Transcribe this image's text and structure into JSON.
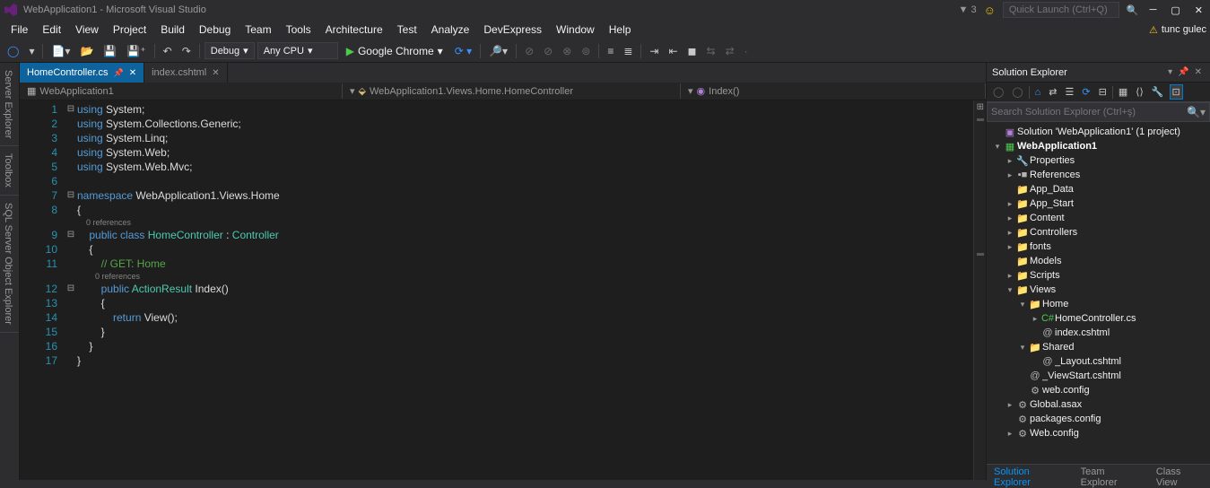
{
  "title": "WebApplication1 - Microsoft Visual Studio",
  "notification_count": "3",
  "quick_launch_placeholder": "Quick Launch (Ctrl+Q)",
  "user_name": "tunc gulec",
  "menu": [
    "File",
    "Edit",
    "View",
    "Project",
    "Build",
    "Debug",
    "Team",
    "Tools",
    "Architecture",
    "Test",
    "Analyze",
    "DevExpress",
    "Window",
    "Help"
  ],
  "toolbar": {
    "debug_config": "Debug",
    "platform": "Any CPU",
    "browser": "Google Chrome"
  },
  "editor_tabs": [
    {
      "label": "HomeController.cs",
      "active": true,
      "pinned": true
    },
    {
      "label": "index.cshtml",
      "active": false,
      "pinned": false
    }
  ],
  "nav": {
    "project": "WebApplication1",
    "type": "WebApplication1.Views.Home.HomeController",
    "member": "Index()"
  },
  "codelens": "0 references",
  "code_lines": [
    {
      "n": 1,
      "fold": "⊟",
      "tokens": [
        [
          "kw",
          "using"
        ],
        [
          "plain",
          " System;"
        ]
      ]
    },
    {
      "n": 2,
      "fold": "",
      "tokens": [
        [
          "kw",
          "using"
        ],
        [
          "plain",
          " System.Collections.Generic;"
        ]
      ]
    },
    {
      "n": 3,
      "fold": "",
      "tokens": [
        [
          "kw",
          "using"
        ],
        [
          "plain",
          " System.Linq;"
        ]
      ]
    },
    {
      "n": 4,
      "fold": "",
      "tokens": [
        [
          "kw",
          "using"
        ],
        [
          "plain",
          " System.Web;"
        ]
      ]
    },
    {
      "n": 5,
      "fold": "",
      "tokens": [
        [
          "kw",
          "using"
        ],
        [
          "plain",
          " System.Web.Mvc;"
        ]
      ]
    },
    {
      "n": 6,
      "fold": "",
      "tokens": [
        [
          "plain",
          ""
        ]
      ]
    },
    {
      "n": 7,
      "fold": "⊟",
      "tokens": [
        [
          "kw",
          "namespace"
        ],
        [
          "plain",
          " WebApplication1.Views.Home"
        ]
      ]
    },
    {
      "n": 8,
      "fold": "",
      "tokens": [
        [
          "plain",
          "{"
        ]
      ]
    },
    {
      "n": 9,
      "fold": "⊟",
      "codelens_before": true,
      "indent": "    ",
      "tokens": [
        [
          "plain",
          "    "
        ],
        [
          "kw",
          "public"
        ],
        [
          "plain",
          " "
        ],
        [
          "kw",
          "class"
        ],
        [
          "plain",
          " "
        ],
        [
          "type",
          "HomeController"
        ],
        [
          "plain",
          " : "
        ],
        [
          "type",
          "Controller"
        ]
      ]
    },
    {
      "n": 10,
      "fold": "",
      "tokens": [
        [
          "plain",
          "    {"
        ]
      ]
    },
    {
      "n": 11,
      "fold": "",
      "tokens": [
        [
          "plain",
          "        "
        ],
        [
          "comment",
          "// GET: Home"
        ]
      ]
    },
    {
      "n": 12,
      "fold": "⊟",
      "codelens_before": true,
      "indent": "        ",
      "tokens": [
        [
          "plain",
          "        "
        ],
        [
          "kw",
          "public"
        ],
        [
          "plain",
          " "
        ],
        [
          "type",
          "ActionResult"
        ],
        [
          "plain",
          " Index()"
        ]
      ]
    },
    {
      "n": 13,
      "fold": "",
      "tokens": [
        [
          "plain",
          "        {"
        ]
      ]
    },
    {
      "n": 14,
      "fold": "",
      "tokens": [
        [
          "plain",
          "            "
        ],
        [
          "kw",
          "return"
        ],
        [
          "plain",
          " View();"
        ]
      ]
    },
    {
      "n": 15,
      "fold": "",
      "tokens": [
        [
          "plain",
          "        }"
        ]
      ]
    },
    {
      "n": 16,
      "fold": "",
      "tokens": [
        [
          "plain",
          "    }"
        ]
      ]
    },
    {
      "n": 17,
      "fold": "",
      "tokens": [
        [
          "plain",
          "}"
        ]
      ]
    }
  ],
  "solution_explorer": {
    "title": "Solution Explorer",
    "search_placeholder": "Search Solution Explorer (Ctrl+ş)",
    "bottom_tabs": [
      "Solution Explorer",
      "Team Explorer",
      "Class View"
    ],
    "tree": [
      {
        "depth": 0,
        "exp": "",
        "icon": "sln",
        "label": "Solution 'WebApplication1' (1 project)"
      },
      {
        "depth": 0,
        "exp": "▾",
        "icon": "proj",
        "label": "WebApplication1",
        "bold": true
      },
      {
        "depth": 1,
        "exp": "▸",
        "icon": "wrench",
        "label": "Properties"
      },
      {
        "depth": 1,
        "exp": "▸",
        "icon": "ref",
        "label": "References"
      },
      {
        "depth": 1,
        "exp": "",
        "icon": "folder",
        "label": "App_Data"
      },
      {
        "depth": 1,
        "exp": "▸",
        "icon": "folder",
        "label": "App_Start"
      },
      {
        "depth": 1,
        "exp": "▸",
        "icon": "folder",
        "label": "Content"
      },
      {
        "depth": 1,
        "exp": "▸",
        "icon": "folder",
        "label": "Controllers"
      },
      {
        "depth": 1,
        "exp": "▸",
        "icon": "folder",
        "label": "fonts"
      },
      {
        "depth": 1,
        "exp": "",
        "icon": "folder",
        "label": "Models"
      },
      {
        "depth": 1,
        "exp": "▸",
        "icon": "folder",
        "label": "Scripts"
      },
      {
        "depth": 1,
        "exp": "▾",
        "icon": "folder",
        "label": "Views"
      },
      {
        "depth": 2,
        "exp": "▾",
        "icon": "folder",
        "label": "Home"
      },
      {
        "depth": 3,
        "exp": "▸",
        "icon": "cs",
        "label": "HomeController.cs"
      },
      {
        "depth": 3,
        "exp": "",
        "icon": "cshtml",
        "label": "index.cshtml"
      },
      {
        "depth": 2,
        "exp": "▾",
        "icon": "folder",
        "label": "Shared"
      },
      {
        "depth": 3,
        "exp": "",
        "icon": "cshtml",
        "label": "_Layout.cshtml"
      },
      {
        "depth": 2,
        "exp": "",
        "icon": "cshtml",
        "label": "_ViewStart.cshtml"
      },
      {
        "depth": 2,
        "exp": "",
        "icon": "config",
        "label": "web.config"
      },
      {
        "depth": 1,
        "exp": "▸",
        "icon": "asax",
        "label": "Global.asax"
      },
      {
        "depth": 1,
        "exp": "",
        "icon": "config",
        "label": "packages.config"
      },
      {
        "depth": 1,
        "exp": "▸",
        "icon": "config",
        "label": "Web.config"
      }
    ]
  },
  "left_rail": [
    "Server Explorer",
    "Toolbox",
    "SQL Server Object Explorer"
  ]
}
